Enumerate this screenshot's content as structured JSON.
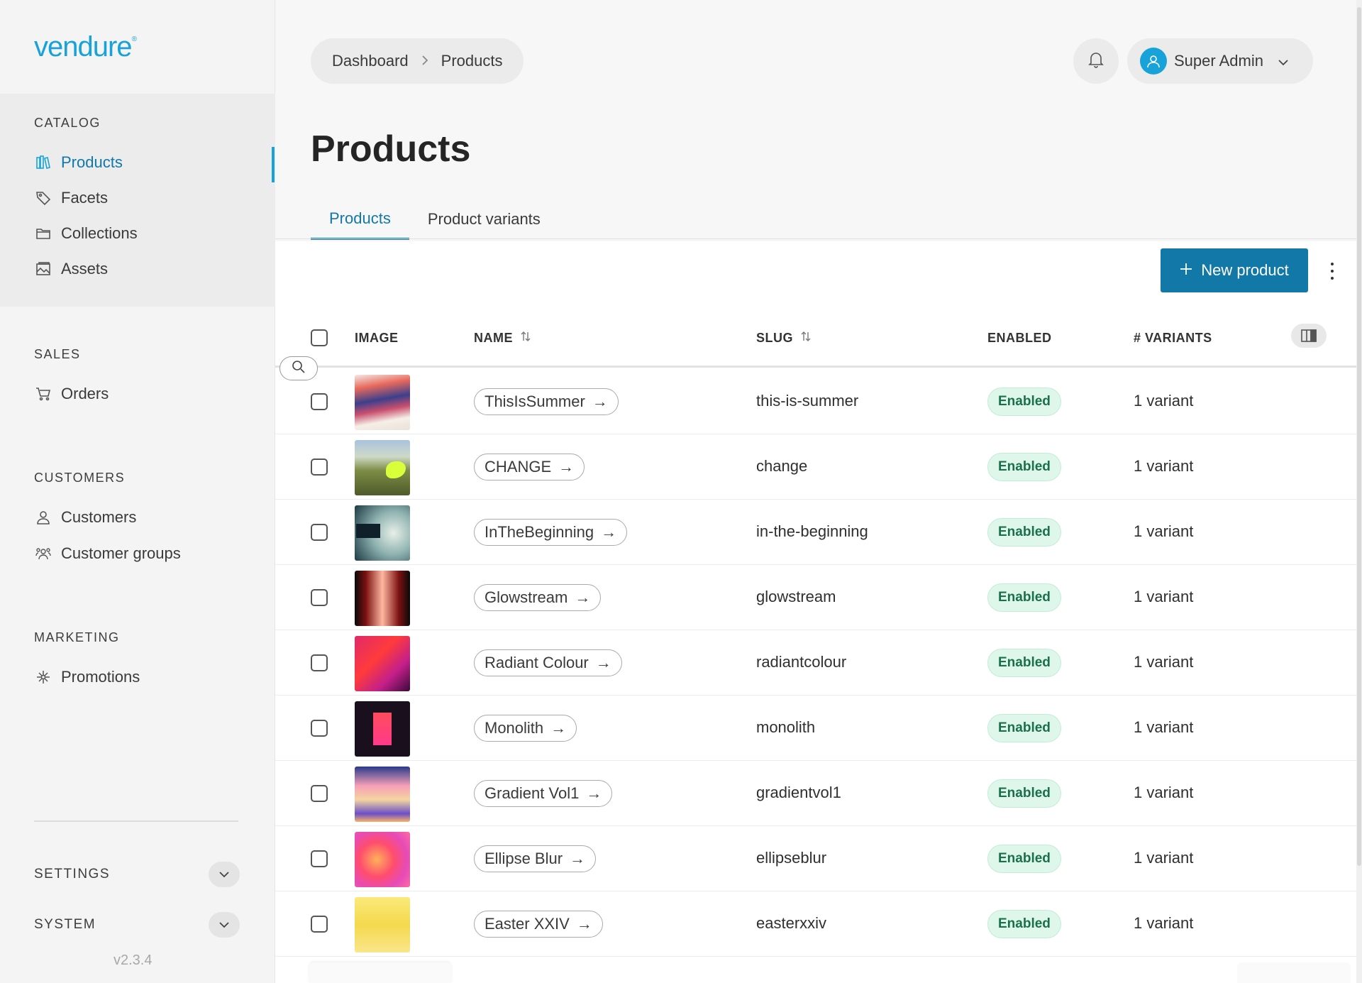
{
  "brand": {
    "logo_text": "vendure",
    "accent": "#17a3d9",
    "primary": "#1178a8"
  },
  "sidebar": {
    "sections": [
      {
        "title": "CATALOG",
        "items": [
          {
            "label": "Products",
            "icon": "book-icon",
            "active": true
          },
          {
            "label": "Facets",
            "icon": "tag-icon"
          },
          {
            "label": "Collections",
            "icon": "folder-icon"
          },
          {
            "label": "Assets",
            "icon": "image-icon"
          }
        ]
      },
      {
        "title": "SALES",
        "items": [
          {
            "label": "Orders",
            "icon": "cart-icon"
          }
        ]
      },
      {
        "title": "CUSTOMERS",
        "items": [
          {
            "label": "Customers",
            "icon": "user-icon"
          },
          {
            "label": "Customer groups",
            "icon": "users-icon"
          }
        ]
      },
      {
        "title": "MARKETING",
        "items": [
          {
            "label": "Promotions",
            "icon": "gift-icon"
          }
        ]
      }
    ],
    "settings_label": "SETTINGS",
    "system_label": "SYSTEM",
    "version": "v2.3.4"
  },
  "header": {
    "breadcrumb": [
      "Dashboard",
      "Products"
    ],
    "user_name": "Super Admin"
  },
  "page": {
    "title": "Products",
    "tabs": [
      "Products",
      "Product variants"
    ],
    "new_button": "New product"
  },
  "table": {
    "columns": [
      "IMAGE",
      "NAME",
      "SLUG",
      "ENABLED",
      "# VARIANTS"
    ],
    "rows": [
      {
        "name": "ThisIsSummer",
        "slug": "this-is-summer",
        "status": "Enabled",
        "variants": "1 variant"
      },
      {
        "name": "CHANGE",
        "slug": "change",
        "status": "Enabled",
        "variants": "1 variant"
      },
      {
        "name": "InTheBeginning",
        "slug": "in-the-beginning",
        "status": "Enabled",
        "variants": "1 variant"
      },
      {
        "name": "Glowstream",
        "slug": "glowstream",
        "status": "Enabled",
        "variants": "1 variant"
      },
      {
        "name": "Radiant Colour",
        "slug": "radiantcolour",
        "status": "Enabled",
        "variants": "1 variant"
      },
      {
        "name": "Monolith",
        "slug": "monolith",
        "status": "Enabled",
        "variants": "1 variant"
      },
      {
        "name": "Gradient Vol1",
        "slug": "gradientvol1",
        "status": "Enabled",
        "variants": "1 variant"
      },
      {
        "name": "Ellipse Blur",
        "slug": "ellipseblur",
        "status": "Enabled",
        "variants": "1 variant"
      },
      {
        "name": "Easter XXIV",
        "slug": "easterxxiv",
        "status": "Enabled",
        "variants": "1 variant"
      }
    ]
  }
}
